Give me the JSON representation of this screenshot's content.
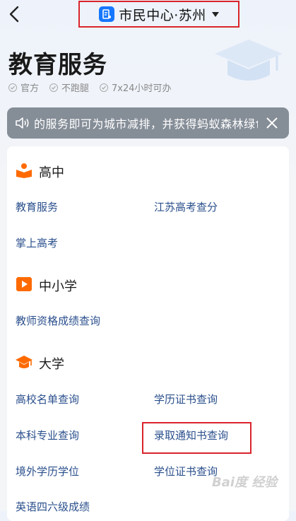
{
  "header": {
    "city_title": "市民中心·苏州"
  },
  "page": {
    "title": "教育服务",
    "tags": [
      {
        "label": "官方"
      },
      {
        "label": "不跑腿"
      },
      {
        "label": "7x24小时可办"
      }
    ]
  },
  "notice": {
    "text": "的服务即可为城市减排，并获得蚂蚁森林绿色"
  },
  "sections": [
    {
      "title": "高中",
      "items": [
        "教育服务",
        "江苏高考查分",
        "掌上高考"
      ]
    },
    {
      "title": "中小学",
      "items": [
        "教师资格成绩查询"
      ]
    },
    {
      "title": "大学",
      "items": [
        "高校名单查询",
        "学历证书查询",
        "本科专业查询",
        "录取通知书查询",
        "境外学历学位",
        "学位证书查询",
        "英语四六级成绩"
      ]
    }
  ],
  "watermark": {
    "text": "Bai度 经验"
  },
  "colors": {
    "accent_red": "#d9252b",
    "link_blue": "#2a4f8c",
    "section_orange": "#ff6a00",
    "brand_blue": "#1677ff",
    "notice_bg": "#858d97"
  }
}
